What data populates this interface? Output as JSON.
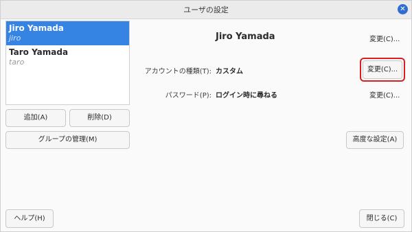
{
  "window": {
    "title": "ユーザの設定",
    "close_glyph": "✕"
  },
  "users": [
    {
      "name": "Jiro Yamada",
      "login": "jiro"
    },
    {
      "name": "Taro Yamada",
      "login": "taro"
    }
  ],
  "list_actions": {
    "add_label": "追加(A)",
    "delete_label": "削除(D)",
    "groups_label": "グループの管理(M)"
  },
  "details": {
    "full_name": "Jiro Yamada",
    "name_change_label": "変更(C)...",
    "account_type_label": "アカウントの種類(T):",
    "account_type_value": "カスタム",
    "account_type_change_label": "変更(C)...",
    "password_label": "パスワード(P):",
    "password_value": "ログイン時に尋ねる",
    "password_change_label": "変更(C)...",
    "advanced_label": "高度な設定(A)"
  },
  "footer": {
    "help_label": "ヘルプ(H)",
    "close_label": "閉じる(C)"
  },
  "colors": {
    "selection": "#3584e4",
    "highlight_border": "#d81e1e",
    "close_button": "#2f6ed0"
  }
}
